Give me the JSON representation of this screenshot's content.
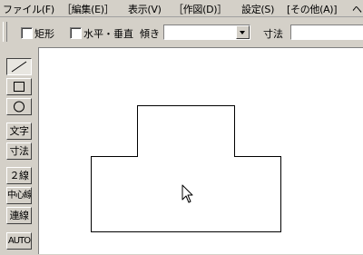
{
  "menu": [
    "ファイル(F)",
    "［編集(E)］",
    "表示(V)",
    "［作図(D)］",
    "設定(S)",
    "[その他(A)]",
    "ヘ"
  ],
  "toolbar": {
    "rect_label": "矩形",
    "rect_checked": false,
    "hv_label": "水平・垂直",
    "hv_checked": false,
    "tilt_label": "傾き",
    "tilt_value": "",
    "dim_label": "寸法",
    "dim_value": ""
  },
  "tools": [
    {
      "name": "line",
      "icon": "line-icon",
      "pressed": true
    },
    {
      "name": "rectangle",
      "icon": "rectangle-icon",
      "pressed": false
    },
    {
      "name": "circle",
      "icon": "circle-icon",
      "pressed": false
    },
    {
      "label": "文字"
    },
    {
      "label": "寸法"
    },
    {
      "label": "２線"
    },
    {
      "label": "中心線"
    },
    {
      "label": "連線"
    },
    {
      "label": "AUTO"
    }
  ],
  "canvas": {
    "shape": "t-shaped-polyline",
    "cursor": "arrow-cursor-icon"
  }
}
